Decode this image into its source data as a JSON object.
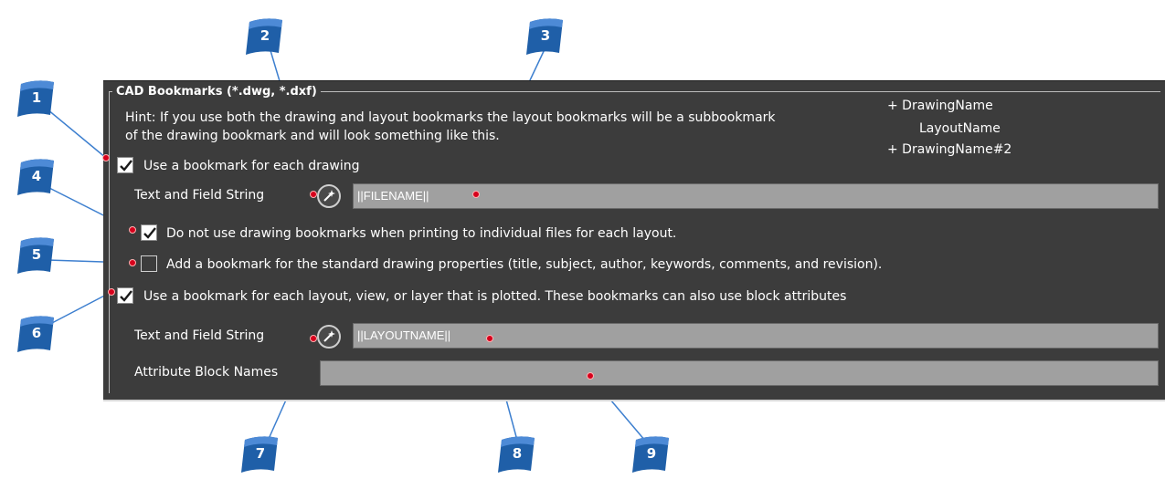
{
  "section": {
    "legend": "CAD Bookmarks (*.dwg, *.dxf)",
    "hint_line1": "Hint: If you use both the drawing and layout bookmarks the layout bookmarks will be a subbookmark",
    "hint_line2": "of the drawing bookmark and will look something like this.",
    "tree": [
      "+ DrawingName",
      "LayoutName",
      "+ DrawingName#2"
    ]
  },
  "options": {
    "drawing_bookmark": {
      "label": "Use a bookmark for each drawing",
      "checked": true
    },
    "drawing_text_label": "Text and Field String",
    "drawing_text_value": "||FILENAME||",
    "no_drawing_bookmarks": {
      "label": "Do not use drawing bookmarks when printing to individual files for each layout.",
      "checked": true
    },
    "standard_properties": {
      "label": "Add a bookmark for the standard drawing properties (title, subject, author, keywords, comments, and revision).",
      "checked": false
    },
    "layout_bookmark": {
      "label": "Use a bookmark for each layout, view, or layer that is plotted.  These bookmarks can also use block attributes",
      "checked": true
    },
    "layout_text_label": "Text and Field String",
    "layout_text_value": "||LAYOUTNAME||",
    "attribute_label": "Attribute Block Names",
    "attribute_value": ""
  },
  "callouts": [
    "1",
    "2",
    "3",
    "4",
    "5",
    "6",
    "7",
    "8",
    "9"
  ],
  "colors": {
    "panel": "#3c3c3c",
    "field": "#a0a0a0",
    "callout": "#1f5fa8",
    "marker": "#d6001c"
  }
}
